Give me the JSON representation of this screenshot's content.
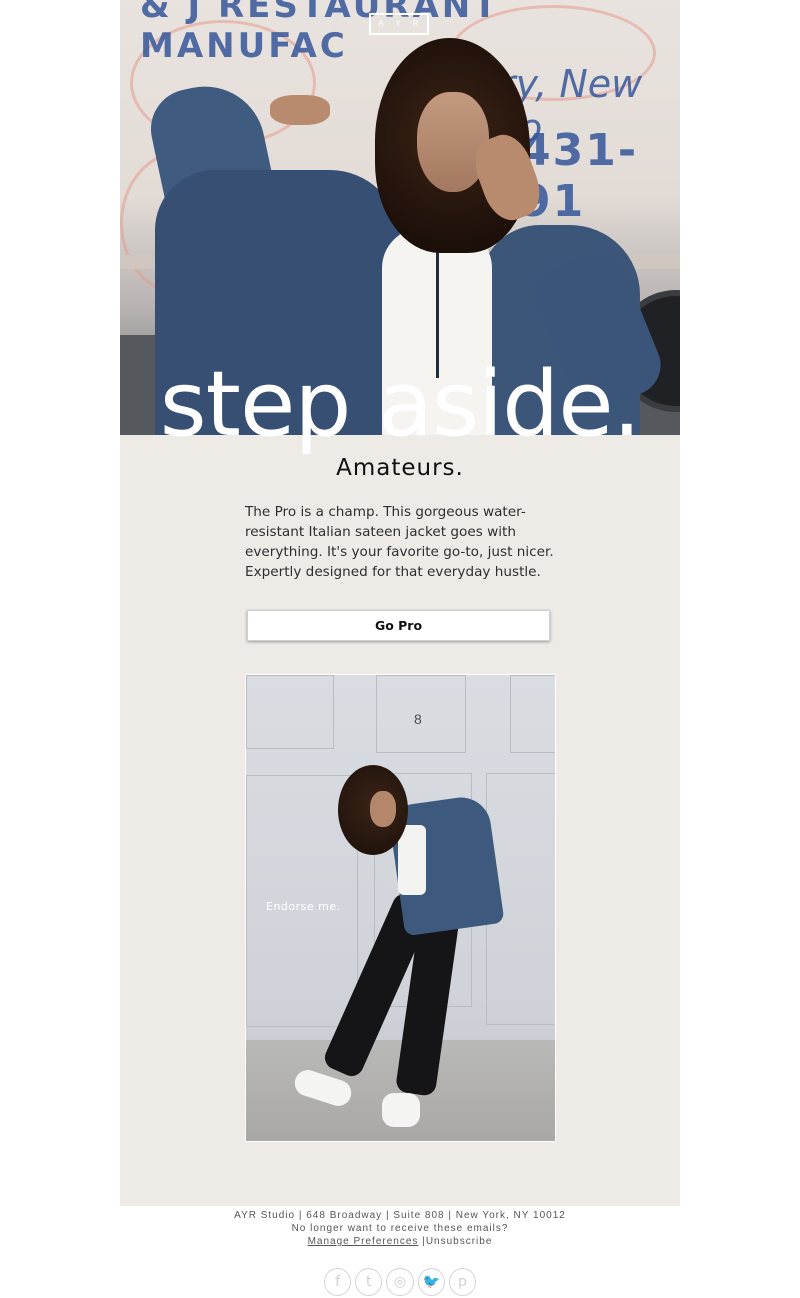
{
  "brand": {
    "logo_text": "A Y R"
  },
  "hero": {
    "background_text_1": "& J RESTAURANT MANUFAC",
    "background_text_2": "ry, New Yo",
    "background_text_3": "431-91"
  },
  "headline": "step aside.",
  "subheadline": "Amateurs.",
  "body_text": "The Pro is a champ. This gorgeous water-resistant Italian sateen jacket goes with everything. It's your favorite go-to, just nicer. Expertly designed for that everyday hustle.",
  "cta_label": "Go Pro",
  "product_photo": {
    "door_number": "8",
    "overlay_text": "Endorse me."
  },
  "footer": {
    "address": "AYR Studio | 648 Broadway | Suite 808 | New York, NY 10012",
    "unsubscribe_prompt": "No longer want to receive these emails?",
    "manage_preferences": "Manage Preferences",
    "separator": " |",
    "unsubscribe": "Unsubscribe"
  },
  "social": {
    "facebook": "f",
    "tumblr": "t",
    "instagram": "◎",
    "twitter": "🐦",
    "pinterest": "p"
  },
  "colors": {
    "email_background": "#eeebe7",
    "jacket_blue": "#3b5679",
    "headline_white": "#ffffff",
    "text_dark": "#111111"
  }
}
